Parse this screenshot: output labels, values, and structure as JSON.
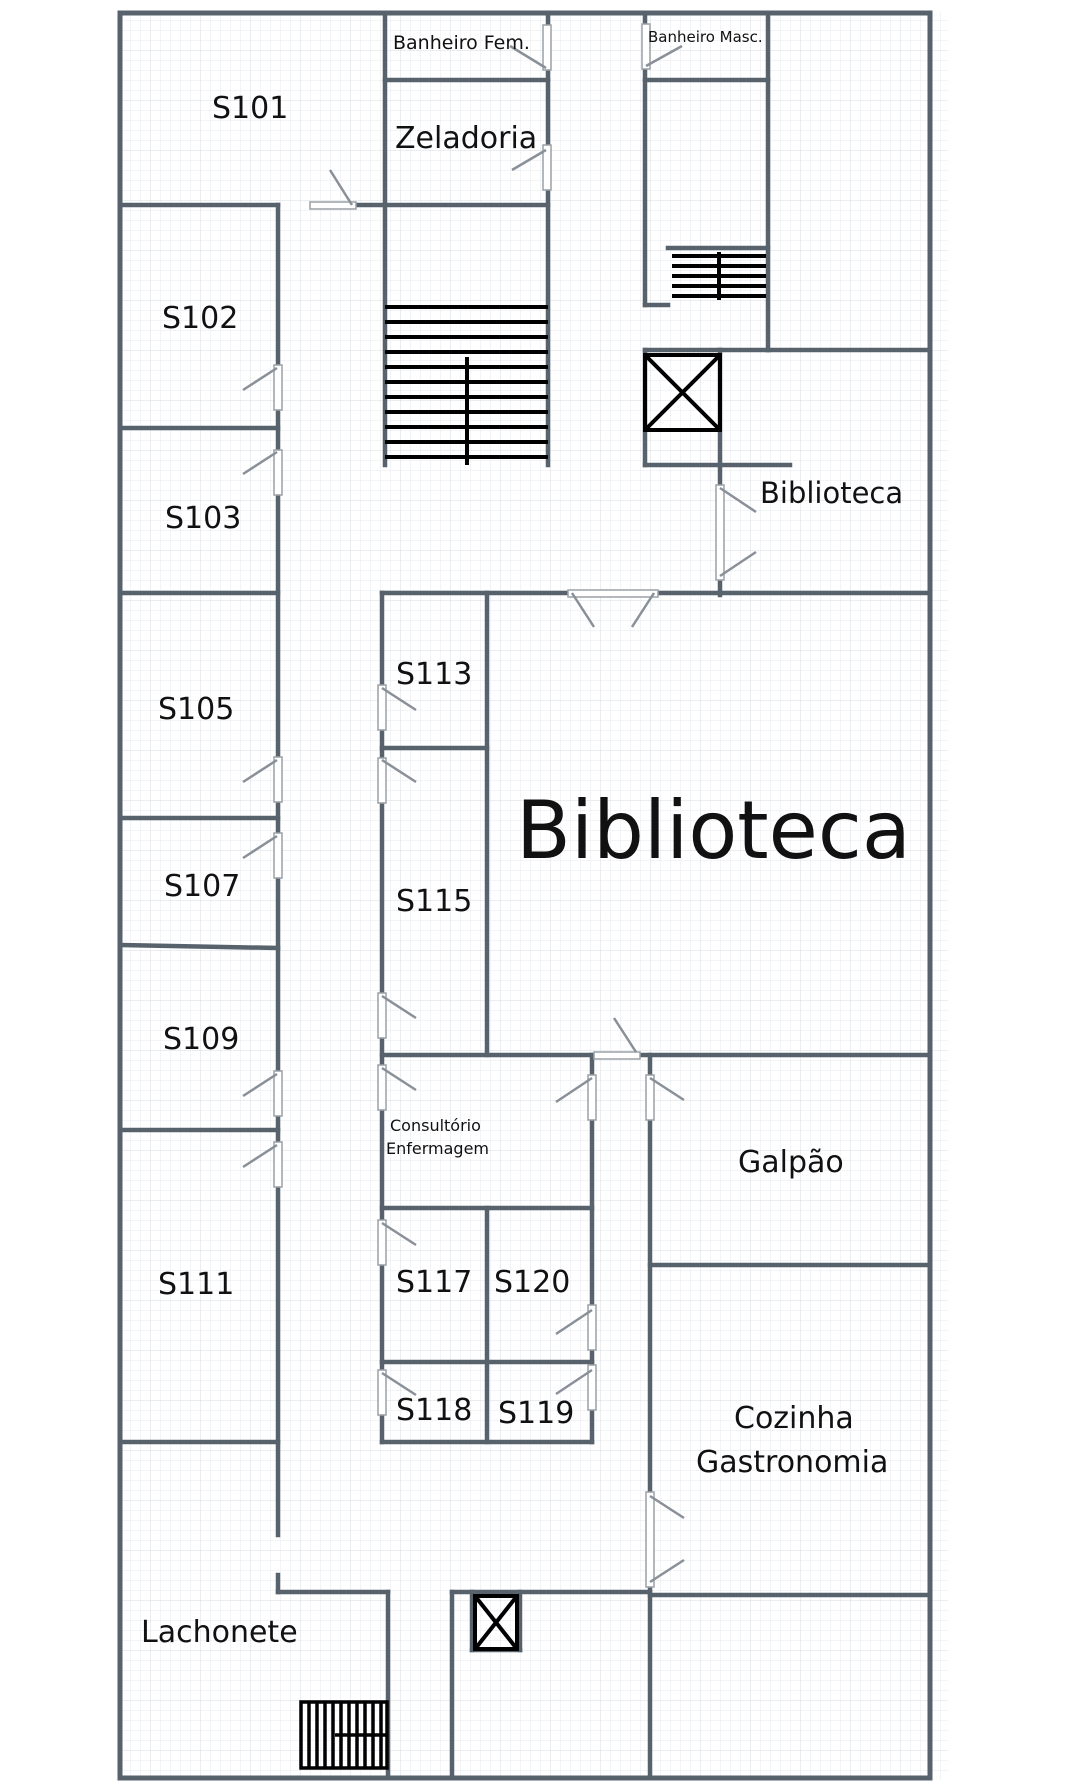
{
  "rooms": {
    "s101": "S101",
    "zeladoria": "Zeladoria",
    "banheiro_fem": "Banheiro Fem.",
    "banheiro_masc": "Banheiro Masc.",
    "s102": "S102",
    "s103": "S103",
    "biblioteca_entrada": "Biblioteca",
    "s105": "S105",
    "s113": "S113",
    "biblioteca": "Biblioteca",
    "s107": "S107",
    "s115": "S115",
    "s109": "S109",
    "consultorio_1": "Consultório",
    "consultorio_2": "Enfermagem",
    "galpao": "Galpão",
    "s111": "S111",
    "s117": "S117",
    "s120": "S120",
    "s118": "S118",
    "s119": "S119",
    "cozinha_1": "Cozinha",
    "cozinha_2": "Gastronomia",
    "lachonete": "Lachonete"
  },
  "colors": {
    "wall": "#57626d",
    "grid": "#e3e7ec",
    "text": "#111111"
  }
}
